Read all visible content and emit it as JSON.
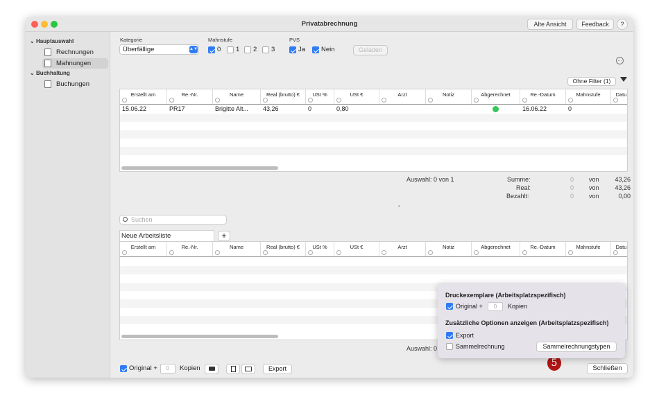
{
  "window": {
    "title": "Privatabrechnung",
    "buttons": {
      "alte_ansicht": "Alte Ansicht",
      "feedback": "Feedback",
      "help": "?"
    }
  },
  "sidebar": {
    "sections": [
      {
        "title": "Hauptauswahl",
        "items": [
          {
            "label": "Rechnungen"
          },
          {
            "label": "Mahnungen",
            "selected": true
          }
        ]
      },
      {
        "title": "Buchhaltung",
        "items": [
          {
            "label": "Buchungen"
          }
        ]
      }
    ]
  },
  "filters": {
    "kategorie_label": "Kategorie",
    "kategorie_value": "Überfällige",
    "mahnstufe_label": "Mahnstufe",
    "mahnstufe_options": [
      {
        "label": "0",
        "checked": true
      },
      {
        "label": "1",
        "checked": false
      },
      {
        "label": "2",
        "checked": false
      },
      {
        "label": "3",
        "checked": false
      }
    ],
    "pvs_label": "PVS",
    "pvs_options": [
      {
        "label": "Ja",
        "checked": true
      },
      {
        "label": "Nein",
        "checked": true
      }
    ],
    "geladen_label": "Geladen",
    "ohne_filter_label": "Ohne Filter (1)",
    "more_icon": "ellipsis-circle-icon",
    "filter_icon": "funnel-icon"
  },
  "columns": [
    "Erstellt am",
    "Re.-Nr.",
    "Name",
    "Real (brutto) €",
    "USt %",
    "USt €",
    "Arzt",
    "Notiz",
    "Abgerechnet",
    "Re.-Datum",
    "Mahnstufe",
    "Datu"
  ],
  "top_table": {
    "rows": [
      {
        "erstellt": "15.06.22",
        "renr": "PR17",
        "name": "Brigitte Alt...",
        "real": "43,26",
        "ust_pct": "0",
        "ust_eur": "0,80",
        "arzt": "",
        "notiz": "",
        "abgerechnet": "check",
        "redatum": "16.06.22",
        "mahnstufe": "0"
      }
    ]
  },
  "summary": {
    "auswahl": "Auswahl:  0 von 1",
    "summe_label": "Summe:",
    "real_label": "Real:",
    "bezahlt_label": "Bezahlt:",
    "summe_sel": "0",
    "real_sel": "0",
    "bezahlt_sel": "0",
    "von": "von",
    "summe_total": "43,26",
    "real_total": "43,26",
    "bezahlt_total": "0,00"
  },
  "search": {
    "placeholder": "Suchen",
    "icon": "magnifier-icon"
  },
  "worklist": {
    "name": "Neue Arbeitsliste",
    "add_label": "+"
  },
  "bottom_table": {
    "auswahl": "Auswahl:  0 von 0"
  },
  "bottom_bar": {
    "original_label": "Original +",
    "copies_value": "0",
    "kopien_label": "Kopien",
    "print_icon": "printer-icon",
    "pdf_icon": "document-icon",
    "mail_icon": "envelope-icon",
    "export_label": "Export",
    "badge": "5",
    "close_label": "Schließen"
  },
  "popover": {
    "druck_title": "Druckexemplare (Arbeitsplatzspezifisch)",
    "original_label": "Original +",
    "copies_value": "0",
    "kopien_label": "Kopien",
    "optionen_title": "Zusätzliche Optionen anzeigen (Arbeitsplatzspezifisch)",
    "export_label": "Export",
    "export_checked": true,
    "sammel_label": "Sammelrechnung",
    "sammel_checked": false,
    "sammeltypen_label": "Sammelrechnungstypen"
  }
}
